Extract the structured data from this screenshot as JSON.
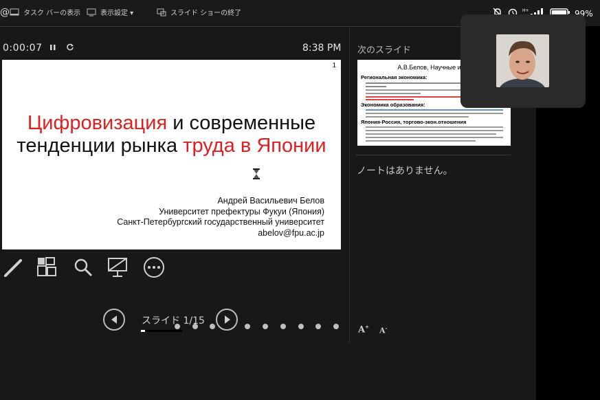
{
  "toolbar": {
    "taskbar_label": "タスク バーの表示",
    "display_settings_label": "表示設定 ▾",
    "end_show_label": "スライド ショーの終了"
  },
  "status_bar": {
    "battery": "99%"
  },
  "presenter": {
    "timer": "0:00:07",
    "clock": "8:38 PM"
  },
  "current_slide": {
    "number": "1",
    "title_part1": "Цифровизация",
    "title_part2": " и современные",
    "title_part3": "тенденции рынка ",
    "title_part4": "труда в Японии",
    "author_name": "Андрей Васильевич Белов",
    "author_affil1": "Университет префектуры Фукуи (Япония)",
    "author_affil2": "Санкт-Петербургский государственный университет",
    "author_email": "abelov@fpu.ac.jp"
  },
  "next_slide": {
    "label": "次のスライド",
    "title": "А.В.Белов, Научные инте",
    "heading1": "Региональная экономика:",
    "heading2": "Экономика образования:",
    "heading3": "Япония-Россия, торгово-экон.отношения"
  },
  "notes": {
    "text": "ノートはありません。"
  },
  "navigation": {
    "slide_counter": "スライド 1/15",
    "progress": 0.1
  },
  "colors": {
    "accent_red": "#e02020",
    "background": "#181818"
  }
}
